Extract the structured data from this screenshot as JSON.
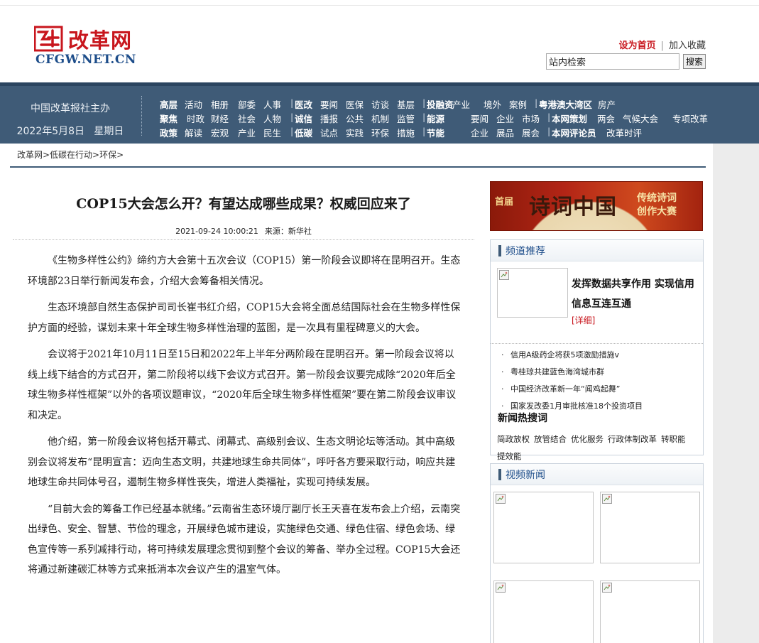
{
  "site": {
    "logo_cn": "改革网",
    "logo_en": "CFGW.NET.CN",
    "top_links": {
      "home": "设为首页",
      "separator": "|",
      "favorite": "加入收藏"
    },
    "search": {
      "value": "站内检索",
      "button": "搜索"
    }
  },
  "navbar": {
    "org": "中国改革报社主办",
    "date": "2022年5月8日",
    "weekday": "星期日",
    "rows": [
      [
        "高层",
        "活动",
        "相册",
        "部委",
        "人事",
        "|",
        "医改",
        "要闻",
        "医保",
        "访谈",
        "基层",
        "|",
        "投融资",
        "产业",
        "境外",
        "案例",
        "|",
        "粤港澳大湾区",
        "房产"
      ],
      [
        "聚焦",
        "时政",
        "财经",
        "社会",
        "人物",
        "|",
        "诚信",
        "播报",
        "公共",
        "机制",
        "监管",
        "|",
        "能源",
        "要闻",
        "企业",
        "市场",
        "|",
        "本网策划",
        "两会",
        "气候大会",
        "专项改革"
      ],
      [
        "政策",
        "解读",
        "宏观",
        "产业",
        "民生",
        "|",
        "低碳",
        "试点",
        "实践",
        "环保",
        "措施",
        "|",
        "节能",
        "企业",
        "展品",
        "展会",
        "|",
        "本网评论员",
        "改革时评"
      ]
    ]
  },
  "breadcrumb": "改革网>低碳在行动>环保>",
  "article": {
    "title": "COP15大会怎么开？有望达成哪些成果？权威回应来了",
    "datetime": "2021-09-24 10:00:21",
    "source": "来源：新华社",
    "paragraphs": [
      "《生物多样性公约》缔约方大会第十五次会议（COP15）第一阶段会议即将在昆明召开。生态环境部23日举行新闻发布会，介绍大会筹备相关情况。",
      "生态环境部自然生态保护司司长崔书红介绍，COP15大会将全面总结国际社会在生物多样性保护方面的经验，谋划未来十年全球生物多样性治理的蓝图，是一次具有里程碑意义的大会。",
      "会议将于2021年10月11日至15日和2022年上半年分两阶段在昆明召开。第一阶段会议将以线上线下结合的方式召开，第二阶段将以线下会议方式召开。第一阶段会议要完成除“2020年后全球生物多样性框架”以外的各项议题审议，“2020年后全球生物多样性框架”要在第二阶段会议审议和决定。",
      "他介绍，第一阶段会议将包括开幕式、闭幕式、高级别会议、生态文明论坛等活动。其中高级别会议将发布“昆明宣言：迈向生态文明，共建地球生命共同体”，呼吁各方要采取行动，响应共建地球生命共同体号召，遏制生物多样性丧失，增进人类福祉，实现可持续发展。",
      "“目前大会的筹备工作已经基本就绪。”云南省生态环境厅副厅长王天喜在发布会上介绍，云南突出绿色、安全、智慧、节俭的理念，开展绿色城市建设，实施绿色交通、绿色住宿、绿色会场、绿色宣传等一系列减排行动，将可持续发展理念贯彻到整个会议的筹备、举办全过程。COP15大会还将通过新建碳汇林等方式来抵消本次会议产生的温室气体。"
    ]
  },
  "banner": {
    "small": "首届",
    "main": "诗词中国",
    "right_line1": "传统诗词",
    "right_line2": "创作大赛"
  },
  "channel": {
    "title": "频道推荐",
    "featured_title": "发挥数据共享作用 实现信用信息互连互通",
    "featured_more": "[详细]",
    "bullet": "·",
    "list": [
      "信用A级药企将获5项激励措施v",
      "粤桂琼共建蓝色海湾城市群",
      "中国经济改革新一年“闻鸡起舞”",
      "国家发改委1月审批核准18个投资项目"
    ],
    "hot_title": "新闻热搜词",
    "hot_tags": [
      "简政放权",
      "放管结合",
      "优化服务",
      "行政体制改革",
      "转职能",
      "提效能"
    ]
  },
  "video": {
    "title": "视频新闻"
  },
  "colors": {
    "brand_red": "#c8161d",
    "nav_bg": "#3f5b77",
    "link_blue": "#1d4d8a"
  }
}
